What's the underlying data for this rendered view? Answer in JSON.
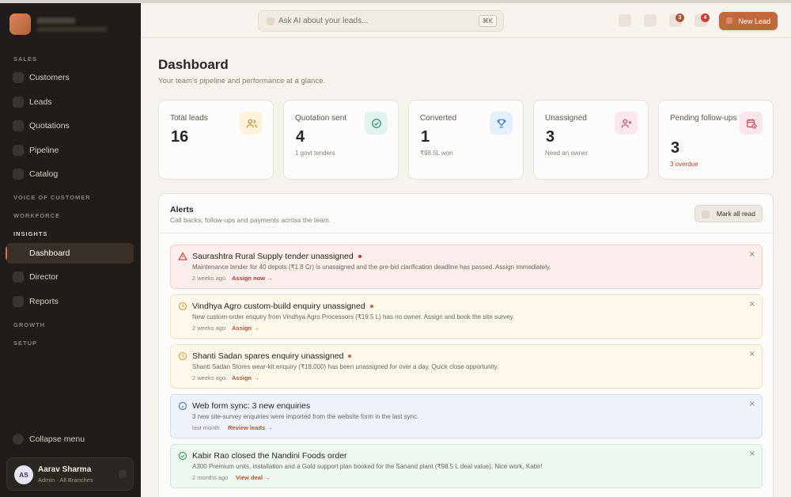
{
  "sidebar": {
    "sections": {
      "sales": "SALES",
      "voice": "VOICE OF CUSTOMER",
      "workforce": "WORKFORCE",
      "insights": "INSIGHTS",
      "growth": "GROWTH",
      "setup": "SETUP"
    },
    "items": {
      "customers": "Customers",
      "leads": "Leads",
      "quotations": "Quotations",
      "pipeline": "Pipeline",
      "catalog": "Catalog",
      "dashboard": "Dashboard",
      "director": "Director",
      "reports": "Reports"
    },
    "collapse": "Collapse menu",
    "user": {
      "initials": "AS",
      "name": "Aarav Sharma",
      "role": "Admin · All Branches"
    }
  },
  "header": {
    "search_placeholder": "Ask AI about your leads...",
    "shortcut": "⌘K",
    "badge_one": "3",
    "badge_two": "4",
    "new_lead": "New Lead"
  },
  "page": {
    "title": "Dashboard",
    "subtitle": "Your team's pipeline and performance at a glance."
  },
  "stats": [
    {
      "label": "Total leads",
      "value": "16",
      "note": "",
      "icon": "users-icon"
    },
    {
      "label": "Quotation sent",
      "value": "4",
      "note": "1 govt tenders",
      "icon": "check-circle-icon"
    },
    {
      "label": "Converted",
      "value": "1",
      "note": "₹98.5L won",
      "icon": "trophy-icon"
    },
    {
      "label": "Unassigned",
      "value": "3",
      "note": "Need an owner",
      "icon": "user-x-icon"
    },
    {
      "label": "Pending follow-ups",
      "value": "3",
      "note": "3 overdue",
      "icon": "calendar-clock-icon"
    }
  ],
  "alerts": {
    "title": "Alerts",
    "subtitle": "Call backs, follow-ups and payments across the team.",
    "mark_all_read": "Mark all read",
    "items": [
      {
        "tone": "red",
        "icon": "warning-icon",
        "title": "Saurashtra Rural Supply tender unassigned",
        "desc": "Maintenance tender for 40 depots (₹1.8 Cr) is unassigned and the pre-bid clarification deadline has passed. Assign immediately.",
        "time": "2 weeks ago",
        "action": "Assign now →"
      },
      {
        "tone": "amber",
        "icon": "clock-icon",
        "title": "Vindhya Agro custom-build enquiry unassigned",
        "desc": "New custom-order enquiry from Vindhya Agro Processors (₹19.5 L) has no owner. Assign and book the site survey.",
        "time": "2 weeks ago",
        "action": "Assign →"
      },
      {
        "tone": "amber",
        "icon": "clock-icon",
        "title": "Shanti Sadan spares enquiry unassigned",
        "desc": "Shanti Sadan Stores wear-kit enquiry (₹18,000) has been unassigned for over a day. Quick close opportunity.",
        "time": "2 weeks ago",
        "action": "Assign →"
      },
      {
        "tone": "blue",
        "icon": "info-icon",
        "title": "Web form sync: 3 new enquiries",
        "desc": "3 new site-survey enquiries were imported from the website form in the last sync.",
        "time": "last month",
        "action": "Review leads →"
      },
      {
        "tone": "green",
        "icon": "check-circle-icon",
        "title": "Kabir Rao closed the Nandini Foods order",
        "desc": "A300 Premium units, installation and a Gold support plan booked for the Sanand plant (₹98.5 L deal value). Nice work, Kabir!",
        "time": "2 months ago",
        "action": "View deal →"
      }
    ]
  },
  "colors": {
    "accent": "#c0693c",
    "sidebar_bg": "#1f1c19",
    "red": "#c23a2c",
    "amber": "#d9a032",
    "blue": "#3f78c8",
    "green": "#3f9a5a"
  }
}
